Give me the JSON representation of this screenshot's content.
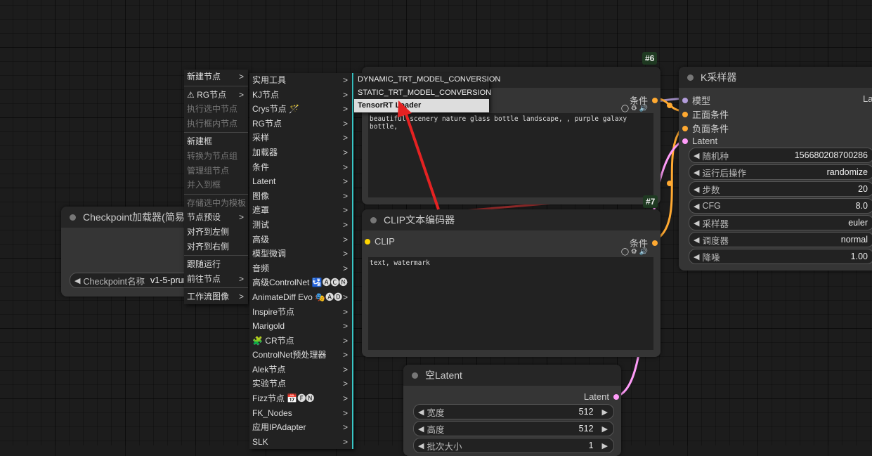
{
  "badges": {
    "n6": "#6",
    "n7": "#7"
  },
  "ksampler": {
    "title": "K采样器",
    "inputs": [
      "模型",
      "正面条件",
      "负面条件",
      "Latent"
    ],
    "output_partial": "La",
    "widgets": [
      {
        "label": "随机种",
        "value": "156680208700286"
      },
      {
        "label": "运行后操作",
        "value": "randomize"
      },
      {
        "label": "步数",
        "value": "20"
      },
      {
        "label": "CFG",
        "value": "8.0"
      },
      {
        "label": "采样器",
        "value": "euler"
      },
      {
        "label": "调度器",
        "value": "normal"
      },
      {
        "label": "降噪",
        "value": "1.00"
      }
    ]
  },
  "clip_top": {
    "output": "条件",
    "text": "beautiful scenery nature glass bottle landscape, , purple galaxy bottle,"
  },
  "clip_bottom": {
    "title": "CLIP文本编码器",
    "input": "CLIP",
    "output": "条件",
    "text": "text, watermark"
  },
  "checkpoint": {
    "title": "Checkpoint加载器(简易",
    "widget_label": "Checkpoint名称",
    "widget_value": "v1-5-prun"
  },
  "empty_latent": {
    "title": "空Latent",
    "output": "Latent",
    "widgets": [
      {
        "label": "宽度",
        "value": "512"
      },
      {
        "label": "高度",
        "value": "512"
      },
      {
        "label": "批次大小",
        "value": "1"
      }
    ]
  },
  "menu1": [
    {
      "label": "新建节点",
      "sub": true,
      "dis": false
    },
    {
      "sep": true
    },
    {
      "label": "RG节点",
      "sub": true,
      "dis": false,
      "icon": true
    },
    {
      "label": "执行选中节点",
      "dis": true
    },
    {
      "label": "执行框内节点",
      "dis": true
    },
    {
      "sep": true
    },
    {
      "label": "新建框",
      "dis": false
    },
    {
      "label": "转换为节点组",
      "dis": true
    },
    {
      "label": "管理组节点",
      "dis": true
    },
    {
      "label": "并入到框",
      "dis": true
    },
    {
      "sep": true
    },
    {
      "label": "存储选中为模板",
      "dis": true
    },
    {
      "label": "节点预设",
      "sub": true,
      "dis": false
    },
    {
      "label": "对齐到左侧",
      "dis": false
    },
    {
      "label": "对齐到右侧",
      "dis": false
    },
    {
      "sep": true
    },
    {
      "label": "跟随运行",
      "dis": false
    },
    {
      "label": "前往节点",
      "sub": true,
      "dis": false
    },
    {
      "sep": true
    },
    {
      "label": "工作流图像",
      "sub": true,
      "dis": false
    }
  ],
  "menu2": [
    "实用工具",
    "KJ节点",
    "Crys节点 🪄",
    "RG节点",
    "采样",
    "加载器",
    "条件",
    "Latent",
    "图像",
    "遮罩",
    "测试",
    "高级",
    "模型微调",
    "音频",
    "高级ControlNet 🛂🅐🅒🅝",
    "AnimateDiff Evo 🎭🅐🅓",
    "Inspire节点",
    "Marigold",
    "🧩 CR节点",
    "ControlNet预处理器",
    "Alek节点",
    "实验节点",
    "Fizz节点 📅🅕🅝",
    "FK_Nodes",
    "应用IPAdapter",
    "SLK"
  ],
  "menu3": [
    {
      "label": "DYNAMIC_TRT_MODEL_CONVERSION",
      "hl": false
    },
    {
      "label": "STATIC_TRT_MODEL_CONVERSION",
      "hl": false
    },
    {
      "label": "TensorRT Loader",
      "hl": true
    }
  ],
  "colors": {
    "model": "#b39ddb",
    "cond": "#ffa931",
    "latent": "#ff9cf9",
    "clip": "#ffd500",
    "link_purple": "#b39ddb",
    "link_red": "#b33",
    "arrow": "#e52222"
  }
}
